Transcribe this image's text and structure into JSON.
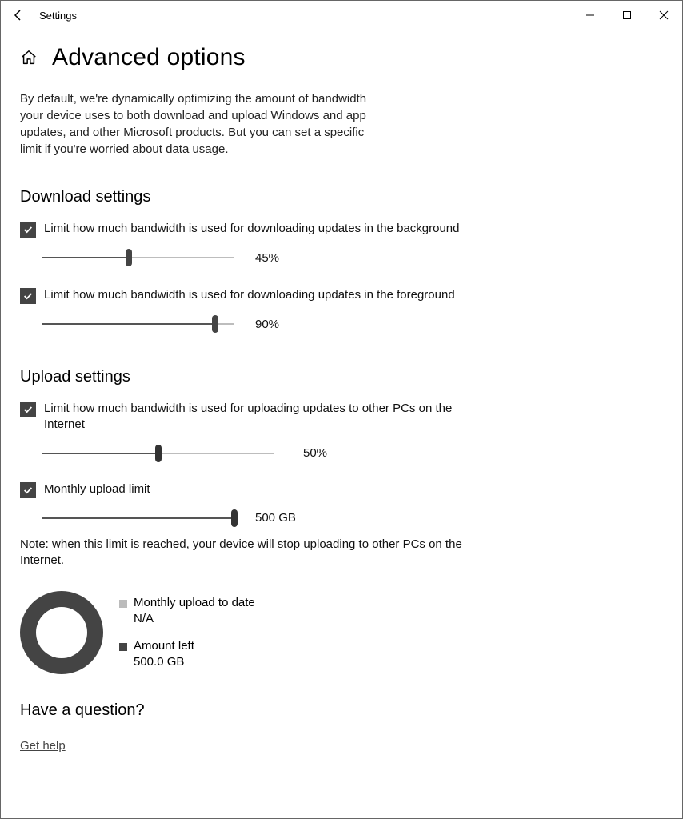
{
  "window": {
    "title": "Settings"
  },
  "page": {
    "heading": "Advanced options",
    "intro": "By default, we're dynamically optimizing the amount of bandwidth your device uses to both download and upload Windows and app updates, and other Microsoft products. But you can set a specific limit if you're worried about data usage."
  },
  "download": {
    "heading": "Download settings",
    "bg_label": "Limit how much bandwidth is used for downloading updates in the background",
    "bg_value": 45,
    "bg_value_text": "45%",
    "fg_label": "Limit how much bandwidth is used for downloading updates in the foreground",
    "fg_value": 90,
    "fg_value_text": "90%"
  },
  "upload": {
    "heading": "Upload settings",
    "bw_label": "Limit how much bandwidth is used for uploading updates to other PCs on the Internet",
    "bw_value": 50,
    "bw_value_text": "50%",
    "monthly_label": "Monthly upload limit",
    "monthly_value": 100,
    "monthly_value_text": "500 GB",
    "note": "Note: when this limit is reached, your device will stop uploading to other PCs on the Internet."
  },
  "usage": {
    "uploaded_label": "Monthly upload to date",
    "uploaded_value": "N/A",
    "left_label": "Amount left",
    "left_value": "500.0 GB"
  },
  "help": {
    "heading": "Have a question?",
    "link": "Get help"
  }
}
